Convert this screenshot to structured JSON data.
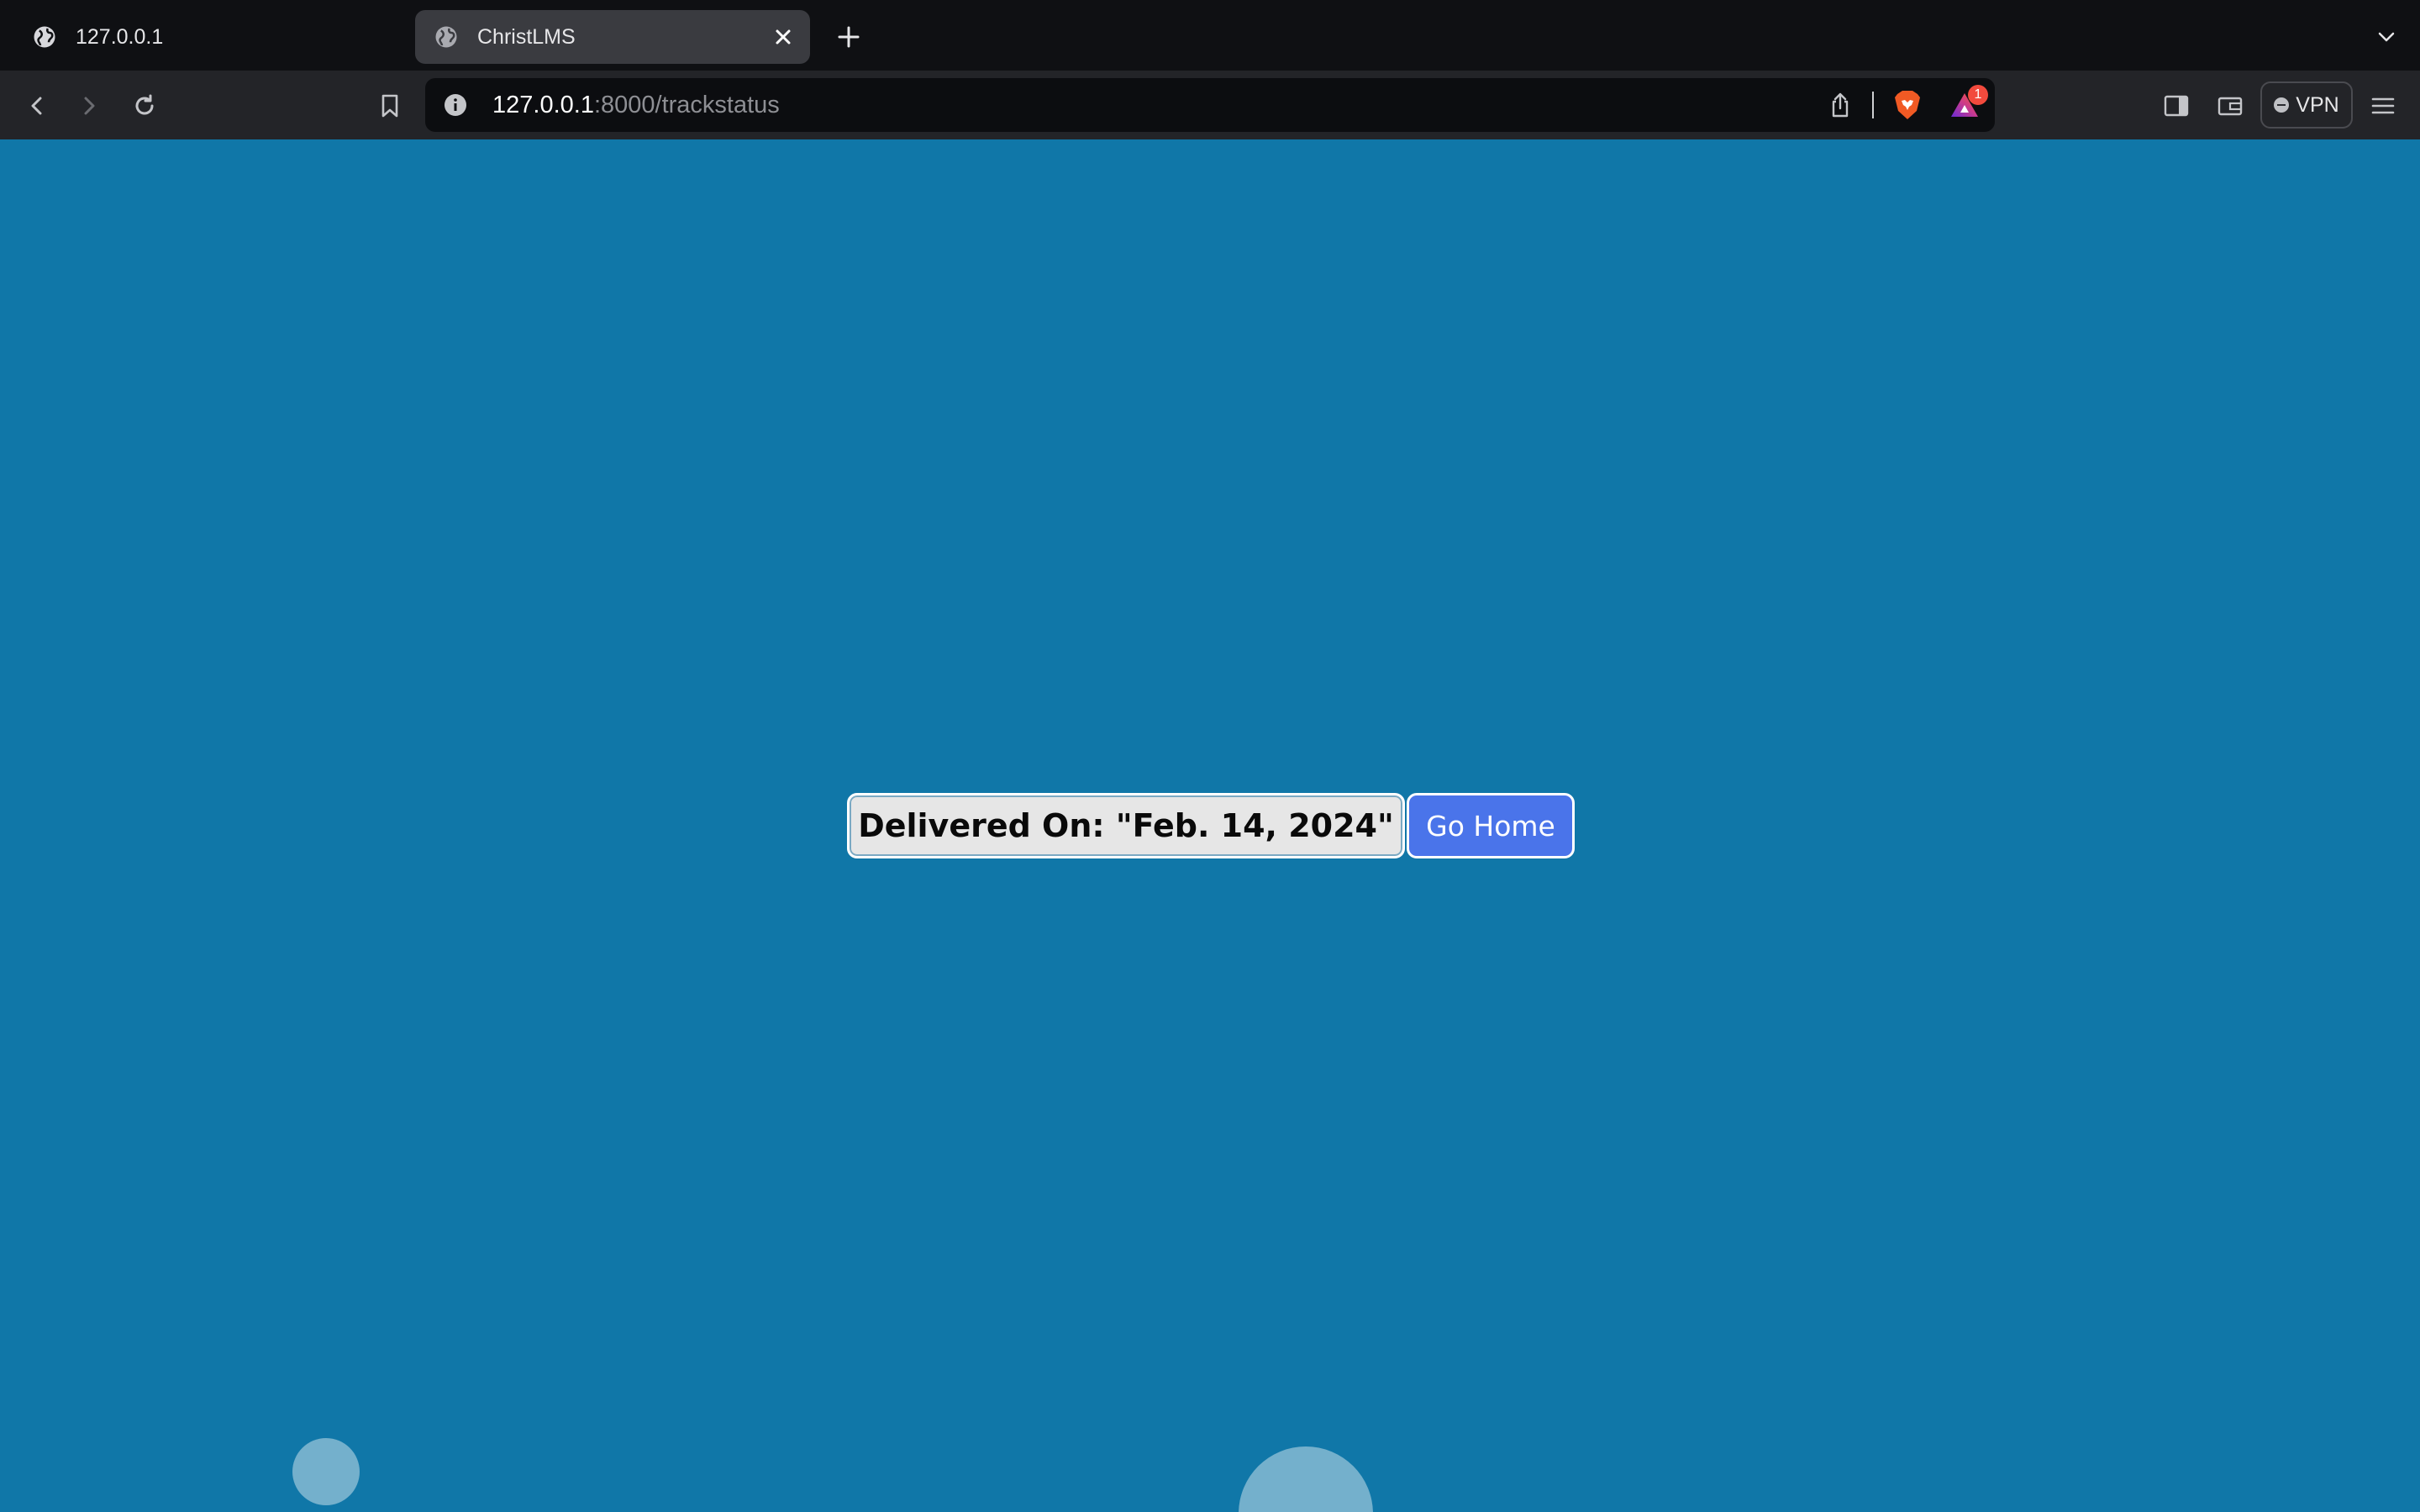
{
  "browser": {
    "tabs": [
      {
        "title": "127.0.0.1",
        "active": false,
        "icon": "globe-icon"
      },
      {
        "title": "ChristLMS",
        "active": true,
        "icon": "globe-icon"
      }
    ],
    "address": {
      "host": "127.0.0.1",
      "path": ":8000/trackstatus"
    },
    "notification_count": "1",
    "vpn_label": "VPN"
  },
  "page": {
    "status_text": "Delivered On: \"Feb. 14, 2024\"",
    "home_button": "Go Home"
  },
  "colors": {
    "page_background": "#1077a8",
    "home_button": "#4a74ea",
    "status_box": "#e6e6e6"
  }
}
